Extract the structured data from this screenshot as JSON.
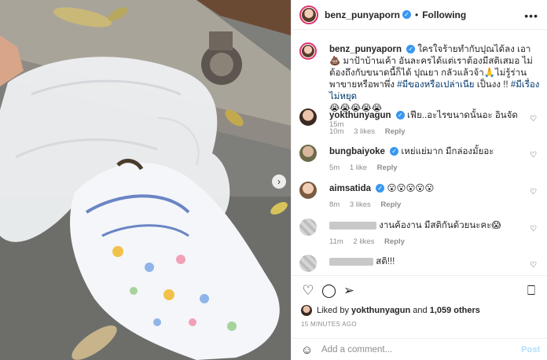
{
  "header": {
    "username": "benz_punyaporn",
    "separator": "•",
    "follow_label": "Following",
    "more_icon": "more-horizontal-icon"
  },
  "caption": {
    "username": "benz_punyaporn",
    "text": "ใครใจร้ายทำกับปุณได้ลง เอา💩 มาป้าบ้านเค้า อันละครได้แต่เราต้องมีสติเสมอ ไม่ต้องถึงกับขนาดนี้ก็ได้ ปุณยา กลัวแล้วจ้า🙏ไม่รู้ร่าน พาขายหรือพาพึ่ง ",
    "hashtag1": "#มีของหรือเปล่าเนีย",
    "text2": " เป็นงง !! ",
    "hashtag2": "#มีเรื่องไม่หยุด",
    "emojis": "😭😭😭😭😭",
    "time": "15m"
  },
  "comments": [
    {
      "username": "yokthunyagun",
      "text": "เฟีย..อะไรขนาดนั้นอะ อินจัด",
      "time": "10m",
      "likes": "3 likes",
      "reply": "Reply",
      "verified": true
    },
    {
      "username": "bungbaiyoke",
      "text": "เหย่แย่มาก มีกล่องมั้ยอะ",
      "time": "5m",
      "likes": "1 like",
      "reply": "Reply",
      "verified": true
    },
    {
      "username": "aimsatida",
      "text": "😮😮😮😮😮",
      "time": "8m",
      "likes": "3 likes",
      "reply": "Reply",
      "verified": true
    },
    {
      "username": "",
      "text": "งานค้องาน มีสติกันด้วยนะคะ😱",
      "time": "11m",
      "likes": "2 likes",
      "reply": "Reply",
      "verified": false
    },
    {
      "username": "",
      "text": "สติ!!!",
      "time": "",
      "likes": "",
      "reply": "",
      "verified": false
    }
  ],
  "actions": {
    "like_icon": "heart-icon",
    "comment_icon": "comment-icon",
    "share_icon": "share-icon",
    "save_icon": "bookmark-icon"
  },
  "likes": {
    "prefix": "Liked by ",
    "user": "yokthunyagun",
    "and": " and ",
    "others": "1,059 others"
  },
  "timestamp": "15 MINUTES AGO",
  "add_comment": {
    "placeholder": "Add a comment...",
    "post_label": "Post"
  },
  "colors": {
    "verified": "#3897f0",
    "story_ring": "#e1306c",
    "post_disabled": "#b2dffc",
    "hashtag": "#00376b"
  }
}
